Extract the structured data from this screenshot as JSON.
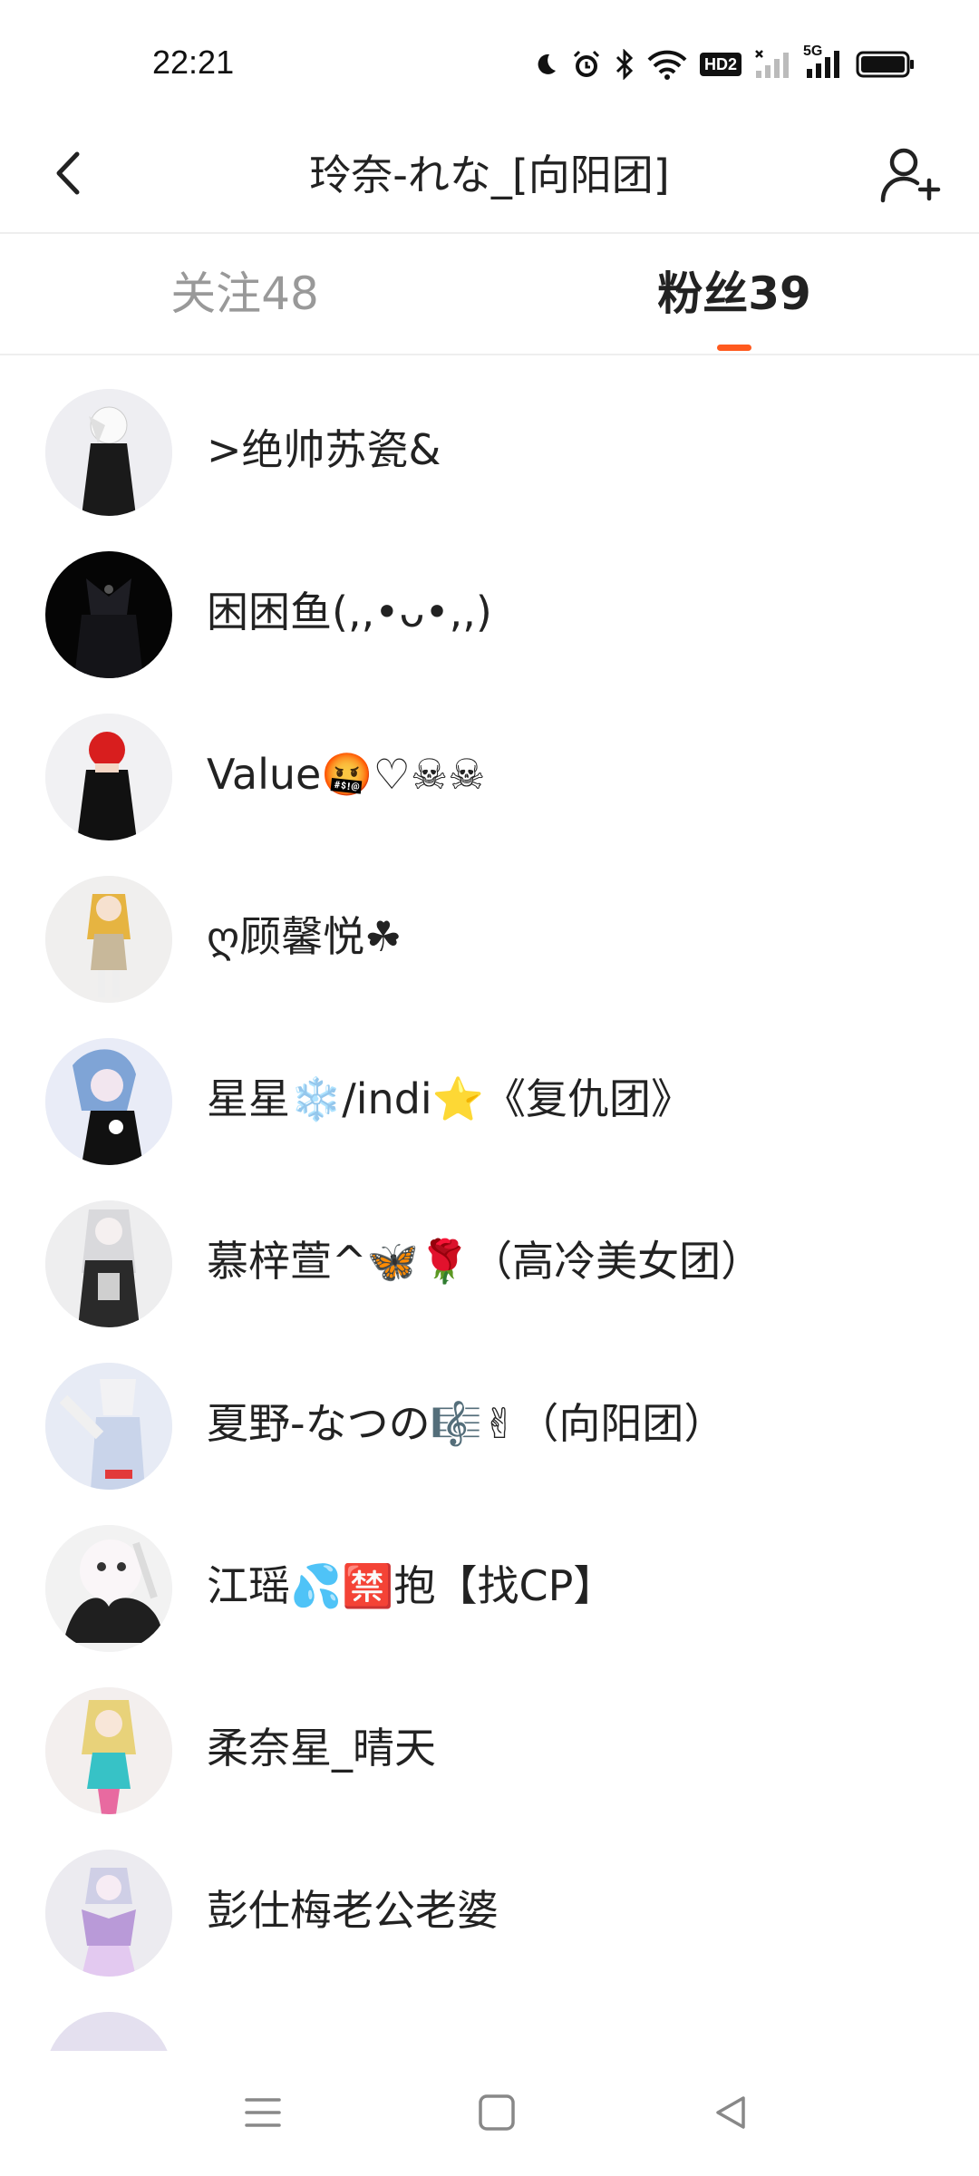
{
  "status_bar": {
    "time": "22:21",
    "icons": [
      "moon-icon",
      "alarm-icon",
      "bluetooth-icon",
      "wifi-icon",
      "hd-icon",
      "signal-icon",
      "signal-5g-icon",
      "battery-icon"
    ],
    "hd_label": "HD2",
    "net_label": "5G"
  },
  "header": {
    "title": "玲奈-れな_[向阳团]",
    "back_icon": "chevron-left-icon",
    "add_icon": "add-user-icon"
  },
  "tabs": [
    {
      "label": "关注",
      "count": "48",
      "active": false
    },
    {
      "label": "粉丝",
      "count": "39",
      "active": true
    }
  ],
  "accent_color": "#ff5a1e",
  "fans": [
    {
      "name": ">绝帅苏瓷&",
      "avatar_color": "#1a1a1a"
    },
    {
      "name": "困困鱼(,,•ᴗ•,,)",
      "avatar_color": "#0f0f10"
    },
    {
      "name": "Value🤬♡☠☠",
      "avatar_color": "#d81e1e"
    },
    {
      "name": "ღ顾馨悦☘",
      "avatar_color": "#e6b441"
    },
    {
      "name": "星星❄️/indi⭐《复仇团》",
      "avatar_color": "#7fa4d6"
    },
    {
      "name": "慕梓萱^🦋🌹（高冷美女团）",
      "avatar_color": "#2a2a2a"
    },
    {
      "name": "夏野-なつの🎼✌（向阳团）",
      "avatar_color": "#c9d4ea"
    },
    {
      "name": "江瑶💦🈲抱【找CP】",
      "avatar_color": "#3a3a3a"
    },
    {
      "name": "柔奈星_晴天",
      "avatar_color": "#e8d27a"
    },
    {
      "name": "彭仕梅老公老婆",
      "avatar_color": "#b99ad8"
    },
    {
      "name": "",
      "avatar_color": "#d9d2ea"
    }
  ],
  "nav": {
    "menu_icon": "menu-icon",
    "home_icon": "home-square-icon",
    "back_icon": "back-triangle-icon"
  }
}
